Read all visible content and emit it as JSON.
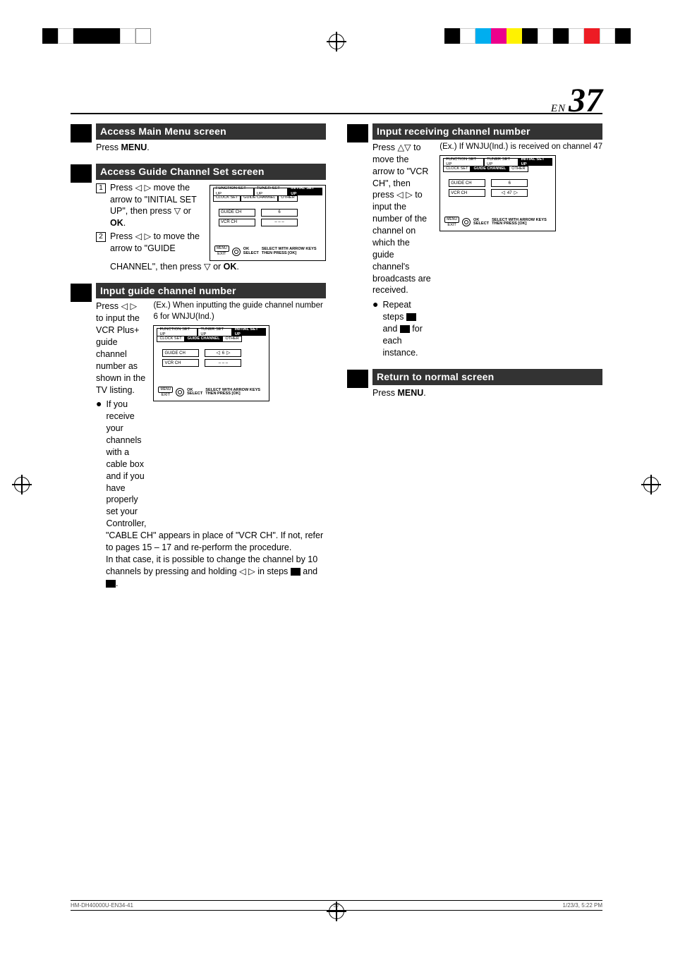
{
  "page": {
    "prefix": "EN",
    "number": "37"
  },
  "left": {
    "s1": {
      "head": "Access Main Menu screen",
      "body": "Press MENU."
    },
    "s2": {
      "head": "Access Guide Channel Set screen",
      "sub1_num": "1",
      "sub1": "Press ◁ ▷ move the arrow to \"INITIAL SET UP\", then press ▽ or OK.",
      "sub2_num": "2",
      "sub2": "Press ◁ ▷ to move the arrow to \"GUIDE CHANNEL\", then press ▽ or OK.",
      "osd": {
        "tabs": [
          "FUNCTION SET UP",
          "TUNER SET UP",
          "INITIAL SET UP"
        ],
        "subtabs": [
          "CLOCK SET",
          "GUIDE CHANNEL",
          "OTHER"
        ],
        "guide_label": "GUIDE CH",
        "guide_val": "6",
        "vcr_label": "VCR CH",
        "vcr_val": "– – –",
        "menu": "MENU",
        "exit": "EXIT",
        "ok": "OK",
        "select": "SELECT",
        "help": "SELECT WITH ARROW KEYS\nTHEN PRESS [OK]"
      }
    },
    "s3": {
      "head": "Input guide channel number",
      "body1": "Press ◁ ▷ to input the VCR Plus+ guide channel number as shown in the TV listing.",
      "example": "(Ex.) When inputting the guide channel number 6 for WNJU(Ind.)",
      "bullet": "If you receive your channels with a cable box and if you have properly set your Controller, \"CABLE CH\" appears in place of \"VCR CH\". If not, refer to pages 15 – 17 and re-perform the procedure.",
      "body2": "In that case, it is possible to change the channel by 10 channels by pressing and holding ◁ ▷ in steps ■ and ■.",
      "osd": {
        "tabs": [
          "FUNCTION SET UP",
          "TUNER SET UP",
          "INITIAL SET UP"
        ],
        "subtabs": [
          "CLOCK SET",
          "GUIDE CHANNEL",
          "OTHER"
        ],
        "guide_label": "GUIDE CH",
        "guide_val": "6",
        "vcr_label": "VCR CH",
        "vcr_val": "– – –",
        "menu": "MENU",
        "exit": "EXIT",
        "ok": "OK",
        "select": "SELECT",
        "help": "SELECT WITH ARROW KEYS\nTHEN PRESS [OK]"
      }
    }
  },
  "right": {
    "s4": {
      "head": "Input receiving channel number",
      "body": "Press △▽ to move the arrow to \"VCR CH\", then press ◁ ▷ to input the number of the channel on which the guide channel's broadcasts are received.",
      "example": "(Ex.) If WNJU(Ind.) is received on channel 47",
      "bullet": "Repeat steps ■ and ■ for each instance.",
      "osd": {
        "tabs": [
          "FUNCTION SET UP",
          "TUNER SET UP",
          "INITIAL SET UP"
        ],
        "subtabs": [
          "CLOCK SET",
          "GUIDE CHANNEL",
          "OTHER"
        ],
        "guide_label": "GUIDE CH",
        "guide_val": "6",
        "vcr_label": "VCR CH",
        "vcr_val": "47",
        "menu": "MENU",
        "exit": "EXIT",
        "ok": "OK",
        "select": "SELECT",
        "help": "SELECT WITH ARROW KEYS\nTHEN PRESS [OK]"
      }
    },
    "s5": {
      "head": "Return to normal screen",
      "body": "Press MENU."
    }
  },
  "footer": {
    "left": "HM-DH40000U-EN34-41",
    "center": "37",
    "right": "1/23/3, 5:22 PM"
  }
}
